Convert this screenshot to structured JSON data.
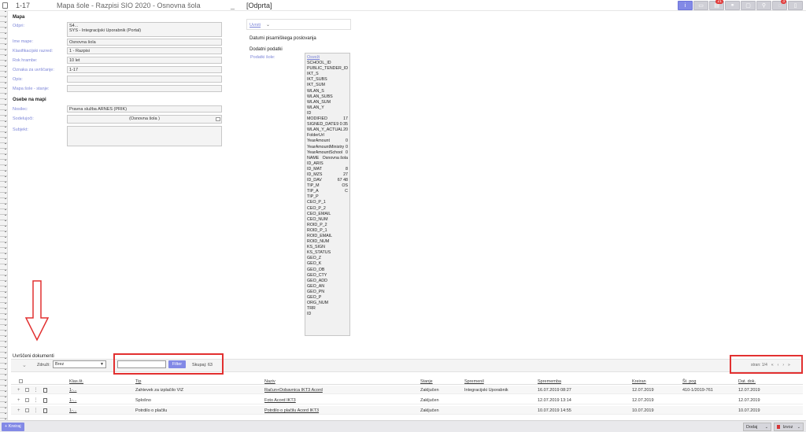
{
  "topbar": {
    "number": "1-17",
    "title": "Mapa šole - Razpisi SIO 2020 - Osnovna šola",
    "dash": "_",
    "status": "[Odprta]",
    "actions": [
      {
        "icon": "info-icon",
        "label": "i",
        "badge": ""
      },
      {
        "icon": "inbox-icon",
        "label": "",
        "badge": ""
      },
      {
        "icon": "document-icon",
        "label": "",
        "badge": "21"
      },
      {
        "icon": "link-icon",
        "label": "",
        "badge": ""
      },
      {
        "icon": "lock-icon",
        "label": "",
        "badge": ""
      },
      {
        "icon": "search-icon",
        "label": "",
        "badge": ""
      },
      {
        "icon": "comment-icon",
        "label": "",
        "badge": "3"
      },
      {
        "icon": "file-icon",
        "label": "",
        "badge": ""
      }
    ]
  },
  "mapa": {
    "heading": "Mapa",
    "odpri_label": "Odpri:",
    "odpri_line1": "S4...",
    "odpri_line2": "SYS - Integracijski Uporabnik (Portal)",
    "ime_label": "Ime mape:",
    "ime_value": "Osnovna šola",
    "klas_label": "Klasifikacijski razred:",
    "klas_value": "1 - Razpisi",
    "rok_label": "Rok hrambe:",
    "rok_value": "10 let",
    "oznaka_label": "Oznaka za uvrščanje:",
    "oznaka_value": "1-17",
    "opis_label": "Opis:",
    "opis_value": "",
    "stanje_label": "Mapa šole - stanje:",
    "stanje_value": ""
  },
  "osebe": {
    "heading": "Osebe na mapi",
    "nosilec_label": "Nosilec:",
    "nosilec_value": "Pravna služba ARNES (PRIK)",
    "sodelujoci_label": "Sodelujoči:",
    "sodelujoci_value": "(Osnovna šola                    )",
    "subjekt_label": "Subjekt:"
  },
  "middle": {
    "uvrsti_link": "Uvrsti",
    "datumi_heading": "Datumi pisarniškega poslovanja",
    "dodatni_heading": "Dodatni podatki",
    "podatki_label": "Podatki šole:",
    "fields": [
      {
        "k": "Osveži",
        "v": ""
      },
      {
        "k": "SCHOOL_ID",
        "v": ""
      },
      {
        "k": "PUBLIC_TENDER_ID",
        "v": ""
      },
      {
        "k": "IKT_S",
        "v": ""
      },
      {
        "k": "IKT_SUBS",
        "v": ""
      },
      {
        "k": "IKT_SUM",
        "v": ""
      },
      {
        "k": "WLAN_S",
        "v": ""
      },
      {
        "k": "WLAN_SUBS",
        "v": ""
      },
      {
        "k": "WLAN_SUM",
        "v": ""
      },
      {
        "k": "WLAN_Y",
        "v": ""
      },
      {
        "k": "ID",
        "v": ""
      },
      {
        "k": "MODIFIED",
        "v": "17"
      },
      {
        "k": "SIGNED_DATE",
        "v": "9  0:35"
      },
      {
        "k": "WLAN_Y_ACTUAL",
        "v": "20"
      },
      {
        "k": "FolderUrl",
        "v": ""
      },
      {
        "k": "YearAmount",
        "v": "0"
      },
      {
        "k": "YearAmountMinistry",
        "v": "0"
      },
      {
        "k": "YearAmountSchool",
        "v": "0"
      },
      {
        "k": "NAME",
        "v": "Osnovna šola"
      },
      {
        "k": "ID_ARIS",
        "v": ""
      },
      {
        "k": "ID_MAT",
        "v": "8"
      },
      {
        "k": "ID_MZS",
        "v": "27"
      },
      {
        "k": "ID_DAV",
        "v": "67  48"
      },
      {
        "k": "TIP_M",
        "v": "OS"
      },
      {
        "k": "TIP_A",
        "v": "C"
      },
      {
        "k": "TIP_P",
        "v": ""
      },
      {
        "k": "CEO_P_1",
        "v": ""
      },
      {
        "k": "CEO_P_2",
        "v": ""
      },
      {
        "k": "CEO_EMAIL",
        "v": ""
      },
      {
        "k": "CEO_NUM",
        "v": ""
      },
      {
        "k": "ROID_P_2",
        "v": ""
      },
      {
        "k": "ROID_P_1",
        "v": ""
      },
      {
        "k": "ROID_EMAIL",
        "v": ""
      },
      {
        "k": "ROID_NUM",
        "v": ""
      },
      {
        "k": "KS_SIGN",
        "v": ""
      },
      {
        "k": "KS_STATUS",
        "v": ""
      },
      {
        "k": "GEO_Z",
        "v": ""
      },
      {
        "k": "GEO_K",
        "v": ""
      },
      {
        "k": "GEO_OB",
        "v": ""
      },
      {
        "k": "GEO_CTY",
        "v": ""
      },
      {
        "k": "GEO_ADD",
        "v": ""
      },
      {
        "k": "GEO_AN",
        "v": ""
      },
      {
        "k": "GEO_PN",
        "v": ""
      },
      {
        "k": "GEO_P",
        "v": ""
      },
      {
        "k": "ORG_NUM",
        "v": ""
      },
      {
        "k": "TRR",
        "v": ""
      },
      {
        "k": "ID",
        "v": ""
      }
    ]
  },
  "docs": {
    "heading": "Uvrščeni dokumenti",
    "zdruzi_label": "Združi:",
    "zdruzi_value": "Brez",
    "filter_label": "Filter",
    "filter_value": "",
    "skupaj": "Skupaj: 63",
    "pager_text": "stran: 1/4",
    "pager_first": "«",
    "pager_prev": "‹",
    "pager_next": "›",
    "pager_last": "»",
    "headers": {
      "klas": "Klas.št.",
      "tip": "Tip",
      "naziv": "Naziv",
      "stanje": "Stanje",
      "spremenil": "Spremenil",
      "sprememba": "Sprememba",
      "kreiran": "Kreiran",
      "stpog": "Št. pog",
      "datdok": "Dat. dok."
    },
    "rows": [
      {
        "klas": "1-...",
        "tip": "Zahtevek za izplačilo VIZ",
        "naziv": "Račun+Dobavnica IKT3 Acord",
        "stanje": "Zaključen",
        "spremenil": "Integracijski Uporabnik",
        "sprememba": "16.07.2019 08:27",
        "kreiran": "12.07.2019",
        "stpog": "410-1/2019-761",
        "datdok": "12.07.2019"
      },
      {
        "klas": "1-...",
        "tip": "Splošno",
        "naziv": "Foto Acord IKT3",
        "stanje": "Zaključen",
        "spremenil": "",
        "sprememba": "12.07.2019 13:14",
        "kreiran": "12.07.2019",
        "stpog": "",
        "datdok": "12.07.2019"
      },
      {
        "klas": "1-...",
        "tip": "Potrdilo o plačilu",
        "naziv": "Potrdilo o plačilu Acord IKT3",
        "stanje": "Zaključen",
        "spremenil": "",
        "sprememba": "10.07.2019 14:55",
        "kreiran": "10.07.2019",
        "stpog": "",
        "datdok": "10.07.2019"
      }
    ]
  },
  "bottom": {
    "kreiraj": "+ Kreiraj",
    "dodaj": "Dodaj",
    "izvoz": "Izvoz"
  },
  "colors": {
    "accent": "#8289e6",
    "label": "#7d86d8",
    "annotation": "#e23030"
  }
}
